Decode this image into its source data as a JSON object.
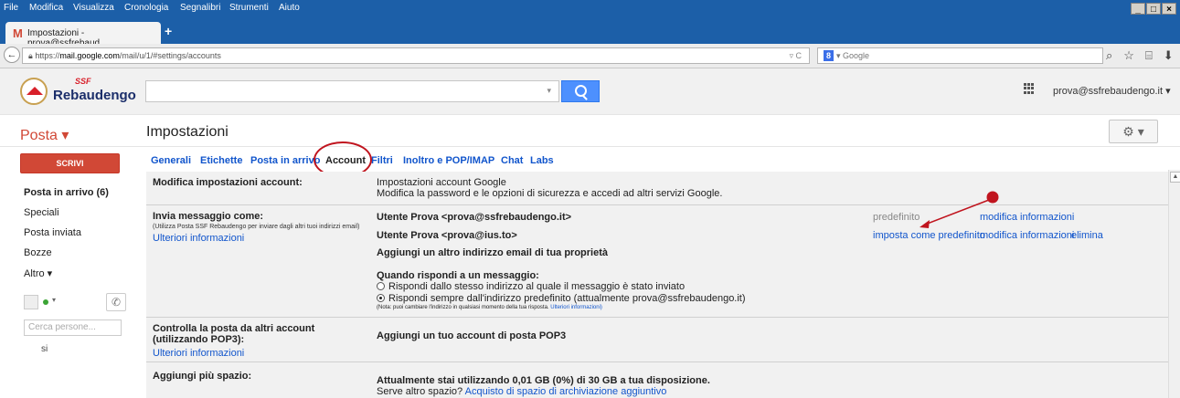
{
  "menubar": {
    "items": [
      "File",
      "Modifica",
      "Visualizza",
      "Cronologia",
      "Segnalibri",
      "Strumenti",
      "Aiuto"
    ],
    "window_controls": [
      "_",
      "□",
      "×"
    ]
  },
  "browser_tab": {
    "title": "Impostazioni - prova@ssfrebaud...",
    "new_tab_label": "+"
  },
  "navbar": {
    "back_label": "←",
    "url_prefix": "https://",
    "url_domain": "mail.google.com",
    "url_path": "/mail/u/1/#settings/accounts",
    "url_controls": "▿ C",
    "search_engine": "8",
    "search_placeholder": "▾ Google",
    "icons": [
      "⌕",
      "☆",
      "⌸",
      "⬇",
      "⌂",
      "≡"
    ]
  },
  "gmail_header": {
    "logo_ssf": "SSF",
    "logo_name": "Rebaudengo",
    "search_value": "",
    "search_dropdown": "▾",
    "account_label": "prova@ssfrebaudengo.it ▾"
  },
  "subheader": {
    "posta_label": "Posta ▾",
    "page_title": "Impostazioni",
    "gear_label": "⚙ ▾"
  },
  "left_nav": {
    "compose_label": "SCRIVI",
    "items": [
      "Posta in arrivo (6)",
      "Speciali",
      "Posta inviata",
      "Bozze",
      "Altro ▾"
    ],
    "chat_status_dropdown": "▾",
    "phone_icon": "✆",
    "people_search_placeholder": "Cerca persone...",
    "contact": "si"
  },
  "settings_tabs": [
    "Generali",
    "Etichette",
    "Posta in arrivo",
    "Account",
    "Filtri",
    "Inoltro e POP/IMAP",
    "Chat",
    "Labs"
  ],
  "sections": {
    "modify_account": {
      "label": "Modifica impostazioni account:",
      "link": "Impostazioni account Google",
      "description": "Modifica la password e le opzioni di sicurezza e accedi ad altri servizi Google."
    },
    "send_as": {
      "label": "Invia messaggio come:",
      "note": "(Utilizza Posta SSF Rebaudengo per inviare dagli altri tuoi indirizzi email)",
      "more_info": "Ulteriori informazioni",
      "addresses": [
        {
          "address": "Utente Prova <prova@ssfrebaudengo.it>",
          "status": "predefinito",
          "actions": [
            "modifica informazioni"
          ]
        },
        {
          "address": "Utente Prova <prova@ius.to>",
          "status": "",
          "actions": [
            "imposta come predefinito",
            "modifica informazioni",
            "elimina"
          ]
        }
      ],
      "add_address": "Aggiungi un altro indirizzo email di tua proprietà",
      "reply_heading": "Quando rispondi a un messaggio:",
      "reply_options": [
        {
          "label": "Rispondi dallo stesso indirizzo al quale il messaggio è stato inviato",
          "selected": false
        },
        {
          "label": "Rispondi sempre dall'indirizzo predefinito (attualmente prova@ssfrebaudengo.it)",
          "selected": true
        }
      ],
      "reply_note": "(Nota: puoi cambiare l'indirizzo in qualsiasi momento della tua risposta.",
      "reply_note_link": "Ulteriori informazioni)"
    },
    "check_mail": {
      "label": "Controlla la posta da altri account (utilizzando POP3):",
      "more_info": "Ulteriori informazioni",
      "action": "Aggiungi un tuo account di posta POP3"
    },
    "storage": {
      "label": "Aggiungi più spazio:",
      "usage": "Attualmente stai utilizzando 0,01 GB (0%) di 30 GB a tua disposizione.",
      "more_question": "Serve altro spazio?",
      "more_link": "Acquisto di spazio di archiviazione aggiuntivo"
    }
  },
  "annotation_colors": {
    "marker": "#c0141e"
  }
}
